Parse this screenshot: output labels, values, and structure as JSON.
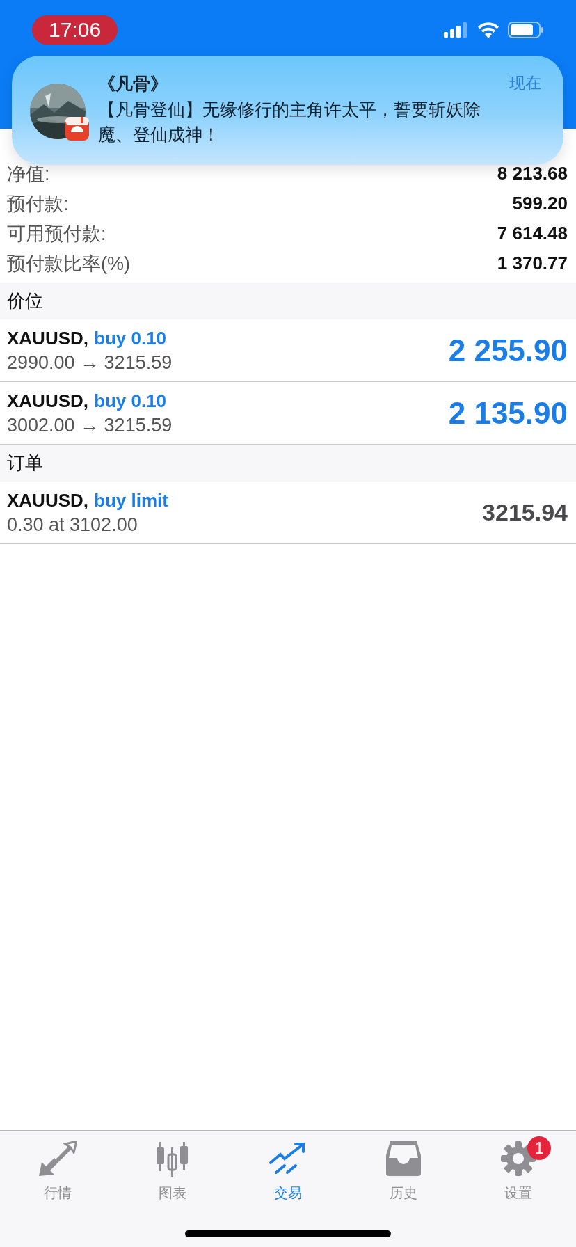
{
  "status_bar": {
    "time": "17:06"
  },
  "notification": {
    "title": "《凡骨》",
    "time": "现在",
    "body": "【凡骨登仙】无缘修行的主角许太平，誓要斩妖除魔、登仙成神！"
  },
  "summary": [
    {
      "label": "净值:",
      "value": "8 213.68"
    },
    {
      "label": "预付款:",
      "value": "599.20"
    },
    {
      "label": "可用预付款:",
      "value": "7 614.48"
    },
    {
      "label": "预付款比率(%)",
      "value": "1 370.77"
    }
  ],
  "sections": [
    {
      "title": "价位",
      "rows": [
        {
          "symbol": "XAUUSD,",
          "action": "buy 0.10",
          "detail": "2990.00 → 3215.59",
          "amount": "2 255.90",
          "kind": "position"
        },
        {
          "symbol": "XAUUSD,",
          "action": "buy 0.10",
          "detail": "3002.00 → 3215.59",
          "amount": "2 135.90",
          "kind": "position"
        }
      ]
    },
    {
      "title": "订单",
      "rows": [
        {
          "symbol": "XAUUSD,",
          "action": "buy limit",
          "detail": "0.30 at 3102.00",
          "amount": "3215.94",
          "kind": "order"
        }
      ]
    }
  ],
  "tabs": [
    {
      "label": "行情",
      "kind": "quotes",
      "selected": false
    },
    {
      "label": "图表",
      "kind": "chart",
      "selected": false
    },
    {
      "label": "交易",
      "kind": "trade",
      "selected": true
    },
    {
      "label": "历史",
      "kind": "history",
      "selected": false
    },
    {
      "label": "设置",
      "kind": "settings",
      "selected": false,
      "badge": "1"
    }
  ]
}
